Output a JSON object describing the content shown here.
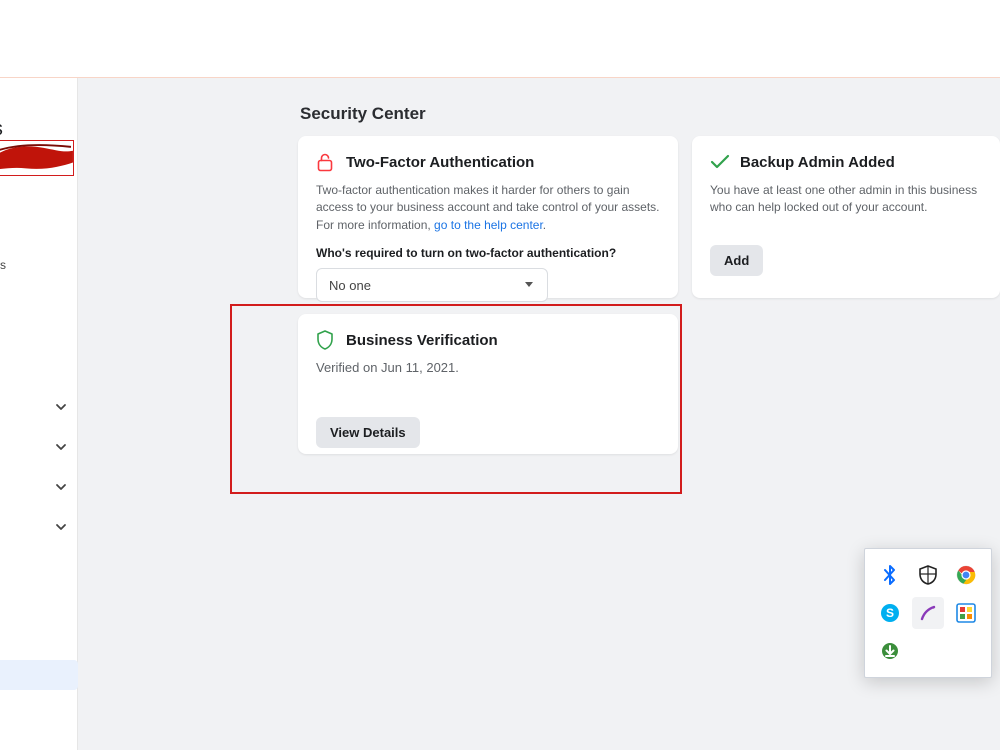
{
  "sidebar": {
    "title_fragment": "gs",
    "sublabel": "s",
    "chevron_count": 4
  },
  "page": {
    "title": "Security Center"
  },
  "two_factor": {
    "title": "Two-Factor Authentication",
    "body_pre": "Two-factor authentication makes it harder for others to gain access to your business account and take control of your assets. For more information, ",
    "body_link": "go to the help center",
    "body_post": ".",
    "question": "Who's required to turn on two-factor authentication?",
    "selected": "No one"
  },
  "backup_admin": {
    "title": "Backup Admin Added",
    "body": "You have at least one other admin in this business who can help locked out of your account.",
    "button": "Add"
  },
  "business_verif": {
    "title": "Business Verification",
    "status": "Verified on Jun 11, 2021.",
    "button": "View Details"
  },
  "tray": {
    "icons": [
      "bluetooth",
      "defender",
      "chrome",
      "skype",
      "groove",
      "snip",
      "idm"
    ]
  }
}
